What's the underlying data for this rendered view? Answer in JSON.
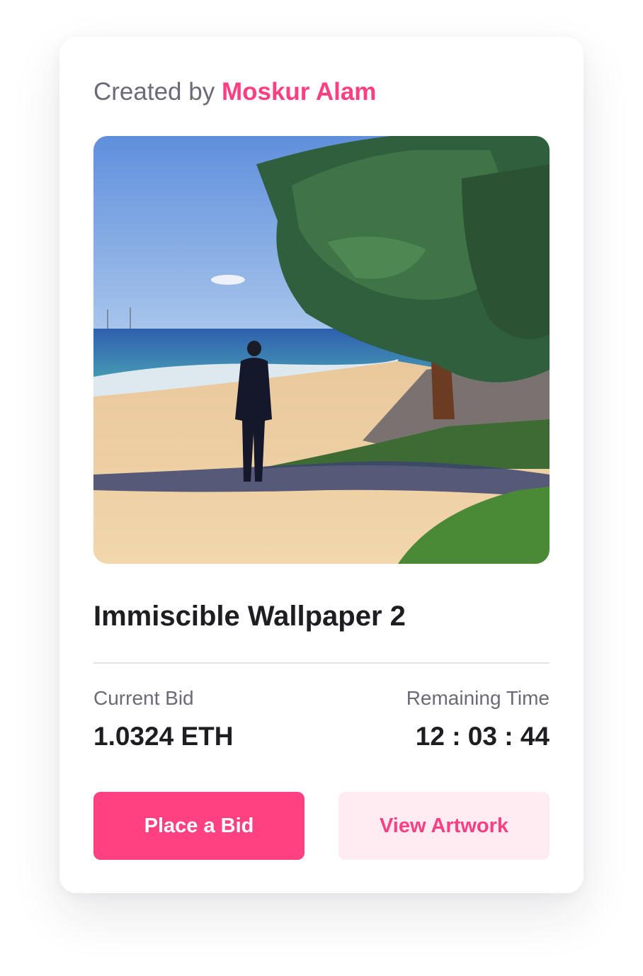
{
  "creator": {
    "prefix": "Created by",
    "name": "Moskur Alam"
  },
  "artwork": {
    "alt": "Painting of a man in a suit standing on a sandy beach under a large pine tree"
  },
  "title": "Immiscible Wallpaper 2",
  "current_bid": {
    "label": "Current Bid",
    "value": "1.0324 ETH"
  },
  "remaining_time": {
    "label": "Remaining Time",
    "value": "12 : 03 : 44"
  },
  "buttons": {
    "place_bid": "Place a Bid",
    "view_artwork": "View Artwork"
  },
  "colors": {
    "accent": "#ff3f7f",
    "accent_light": "#ffecf2",
    "text_dark": "#1d1d22",
    "text_muted": "#6b6b78"
  }
}
